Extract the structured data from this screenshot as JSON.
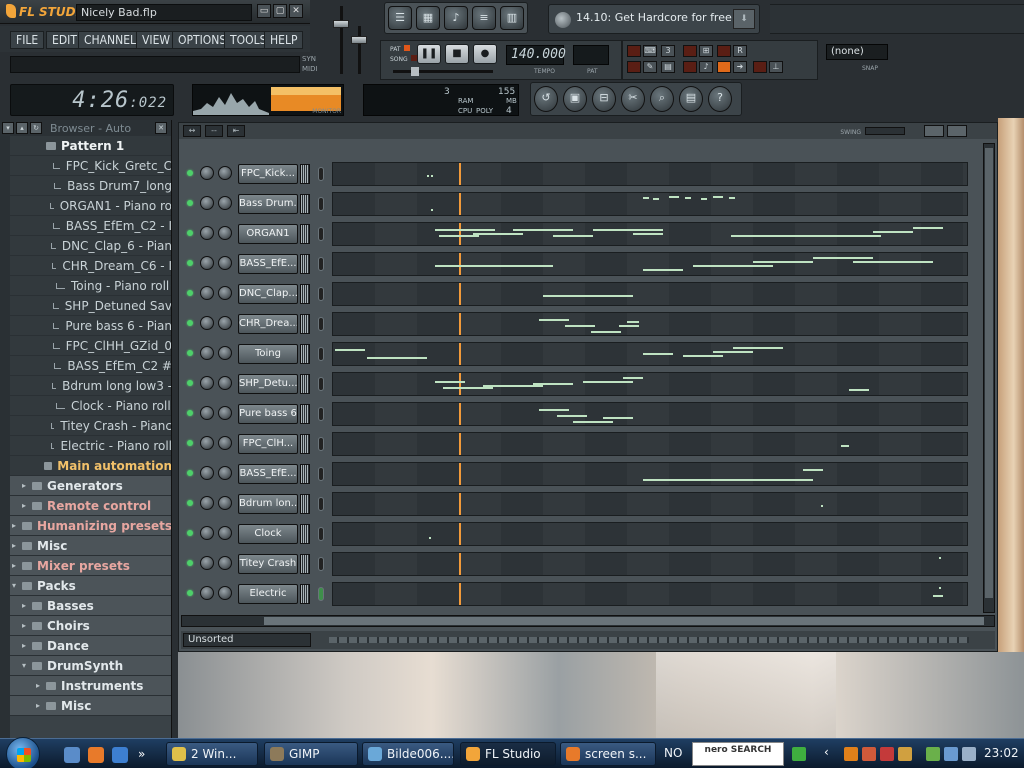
{
  "app": {
    "logo": "FL STUDIO",
    "project": "Nicely Bad.flp",
    "window_buttons": [
      "▭",
      "▢",
      "✕"
    ]
  },
  "menu": [
    "FILE",
    "EDIT",
    "CHANNELS",
    "VIEW",
    "OPTIONS",
    "TOOLS",
    "HELP"
  ],
  "labels": {
    "syn": "SYN",
    "midi": "MIDI",
    "pat": "PAT",
    "song": "SONG",
    "tempo": "TEMPO",
    "pat2": "PAT",
    "monitor": "MONITOR",
    "snap": "SNAP",
    "swing": "SWING",
    "ram": "RAM",
    "cpu": "CPU",
    "poly": "POLY",
    "mb": "MB",
    "pat_ram": "3",
    "ram_val": "155",
    "poly_val": "4"
  },
  "clock": {
    "main": "4:26",
    "ms": ":022"
  },
  "transport": {
    "tempo": "140.000"
  },
  "hint": {
    "text": "14.10: Get Hardcore for free!"
  },
  "snap": {
    "value": "(none)"
  },
  "browser": {
    "title": "Browser - Auto",
    "items": [
      {
        "label": "Pattern 1",
        "kind": "pattern"
      },
      {
        "label": "FPC_Kick_Gretc_C",
        "kind": "file"
      },
      {
        "label": "Bass Drum7_long",
        "kind": "file"
      },
      {
        "label": "ORGAN1 - Piano ro",
        "kind": "file"
      },
      {
        "label": "BASS_EfEm_C2 - I",
        "kind": "file"
      },
      {
        "label": "DNC_Clap_6 - Pian",
        "kind": "file"
      },
      {
        "label": "CHR_Dream_C6 - I",
        "kind": "file"
      },
      {
        "label": "Toing - Piano roll",
        "kind": "file"
      },
      {
        "label": "SHP_Detuned Sav",
        "kind": "file"
      },
      {
        "label": "Pure bass 6 - Pian",
        "kind": "file"
      },
      {
        "label": "FPC_ClHH_GZid_0",
        "kind": "file"
      },
      {
        "label": "BASS_EfEm_C2 #",
        "kind": "file"
      },
      {
        "label": "Bdrum long low3 -",
        "kind": "file"
      },
      {
        "label": "Clock - Piano roll",
        "kind": "file"
      },
      {
        "label": "Titey Crash - Pianc",
        "kind": "file"
      },
      {
        "label": "Electric - Piano roll",
        "kind": "file"
      },
      {
        "label": "Main automation",
        "kind": "auto"
      },
      {
        "label": "Generators",
        "kind": "folder1"
      },
      {
        "label": "Remote control",
        "kind": "folder1pink"
      },
      {
        "label": "Humanizing presets",
        "kind": "folder0pink"
      },
      {
        "label": "Misc",
        "kind": "folder0"
      },
      {
        "label": "Mixer presets",
        "kind": "folder0pink"
      },
      {
        "label": "Packs",
        "kind": "folder0open"
      },
      {
        "label": "Basses",
        "kind": "folder1"
      },
      {
        "label": "Choirs",
        "kind": "folder1"
      },
      {
        "label": "Dance",
        "kind": "folder1"
      },
      {
        "label": "DrumSynth",
        "kind": "folder1open"
      },
      {
        "label": "Instruments",
        "kind": "folder2"
      },
      {
        "label": "Misc",
        "kind": "folder2"
      }
    ]
  },
  "channels": [
    {
      "name": "FPC_Kick...",
      "notes": [
        [
          94,
          12,
          2
        ],
        [
          98,
          12,
          2
        ]
      ]
    },
    {
      "name": "Bass Drum...",
      "notes": [
        [
          310,
          4,
          6
        ],
        [
          320,
          5,
          6
        ],
        [
          336,
          3,
          10
        ],
        [
          352,
          4,
          6
        ],
        [
          368,
          5,
          6
        ],
        [
          380,
          3,
          10
        ],
        [
          396,
          4,
          6
        ],
        [
          98,
          16,
          2
        ]
      ]
    },
    {
      "name": "ORGAN1",
      "notes": [
        [
          102,
          6,
          60
        ],
        [
          106,
          12,
          40
        ],
        [
          140,
          10,
          50
        ],
        [
          180,
          6,
          60
        ],
        [
          220,
          12,
          40
        ],
        [
          260,
          6,
          70
        ],
        [
          300,
          10,
          30
        ],
        [
          398,
          12,
          150
        ],
        [
          540,
          8,
          40
        ],
        [
          580,
          4,
          30
        ]
      ]
    },
    {
      "name": "BASS_EfE...",
      "notes": [
        [
          102,
          12,
          40
        ],
        [
          140,
          12,
          80
        ],
        [
          310,
          16,
          40
        ],
        [
          360,
          12,
          80
        ],
        [
          420,
          8,
          60
        ],
        [
          480,
          4,
          60
        ],
        [
          520,
          8,
          80
        ]
      ]
    },
    {
      "name": "DNC_Clap...",
      "notes": [
        [
          210,
          12,
          90
        ]
      ]
    },
    {
      "name": "CHR_Drea...",
      "notes": [
        [
          206,
          6,
          30
        ],
        [
          232,
          12,
          30
        ],
        [
          258,
          18,
          30
        ],
        [
          286,
          12,
          20
        ],
        [
          294,
          8,
          12
        ]
      ]
    },
    {
      "name": "Toing",
      "notes": [
        [
          2,
          6,
          30
        ],
        [
          34,
          14,
          60
        ],
        [
          310,
          10,
          30
        ],
        [
          350,
          12,
          40
        ],
        [
          380,
          8,
          40
        ],
        [
          400,
          4,
          50
        ]
      ]
    },
    {
      "name": "SHP_Detu...",
      "notes": [
        [
          102,
          8,
          30
        ],
        [
          110,
          14,
          50
        ],
        [
          150,
          12,
          60
        ],
        [
          200,
          10,
          40
        ],
        [
          250,
          8,
          50
        ],
        [
          290,
          4,
          20
        ],
        [
          516,
          16,
          20
        ]
      ]
    },
    {
      "name": "Pure bass 6",
      "notes": [
        [
          206,
          6,
          30
        ],
        [
          224,
          12,
          30
        ],
        [
          240,
          18,
          40
        ],
        [
          270,
          14,
          30
        ]
      ]
    },
    {
      "name": "FPC_ClH...",
      "notes": [
        [
          508,
          12,
          8
        ]
      ]
    },
    {
      "name": "BASS_EfE...",
      "notes": [
        [
          310,
          16,
          170
        ],
        [
          470,
          6,
          20
        ]
      ]
    },
    {
      "name": "Bdrum lon...",
      "notes": [
        [
          488,
          12,
          2
        ]
      ]
    },
    {
      "name": "Clock",
      "notes": [
        [
          96,
          14,
          2
        ]
      ]
    },
    {
      "name": "Titey Crash",
      "notes": [
        [
          606,
          4,
          2
        ]
      ]
    },
    {
      "name": "Electric",
      "notes": [
        [
          600,
          12,
          10
        ],
        [
          606,
          4,
          2
        ]
      ]
    }
  ],
  "seq_footer": {
    "filter": "Unsorted"
  },
  "taskbar": {
    "tasks": [
      "2 Win...",
      "GIMP",
      "Bilde006....",
      "FL Studio",
      "screen s..."
    ],
    "lang": "NO",
    "nero": "nero SEARCH",
    "time": "23:02"
  },
  "colors": {
    "accent": "#f2a53a",
    "led_green": "#4ed06a",
    "note": "#bfe3c2",
    "playhead": "#f29a3a"
  }
}
